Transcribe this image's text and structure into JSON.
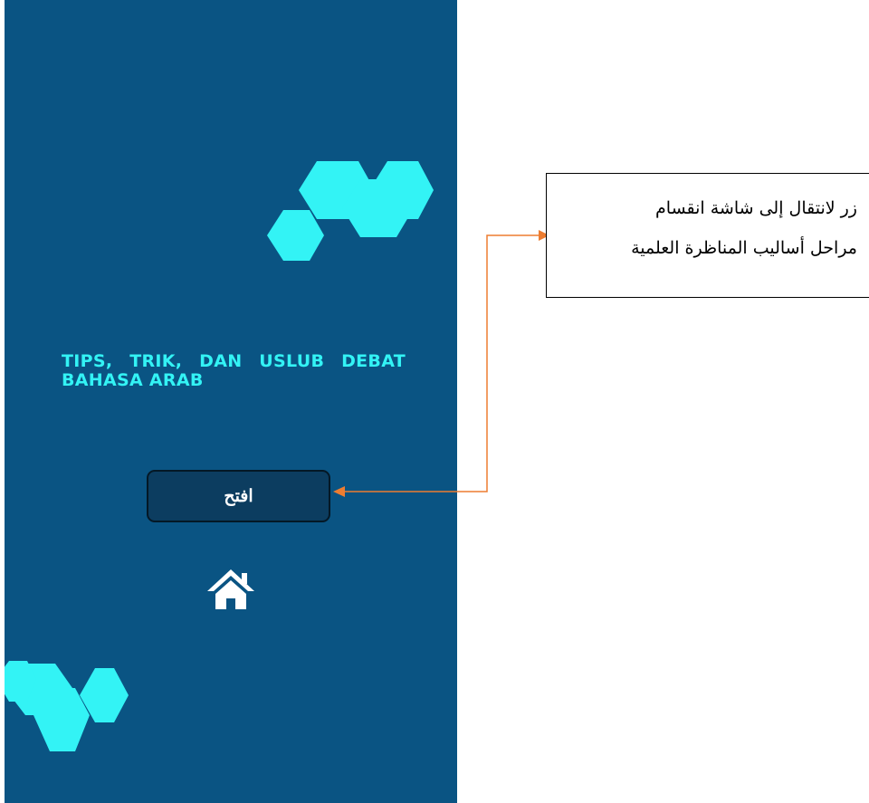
{
  "app": {
    "title": "TIPS, TRIK, DAN USLUB DEBAT BAHASA ARAB",
    "open_button_label": "افتح",
    "home_icon": "home-icon",
    "background_color": "#0a5483",
    "accent_color": "#33f3f5"
  },
  "annotation": {
    "line1": "زر لانتقال إلى شاشة انقسام",
    "line2": "مراحل أساليب المناظرة العلمية",
    "arrow_color": "#ed7d31"
  }
}
